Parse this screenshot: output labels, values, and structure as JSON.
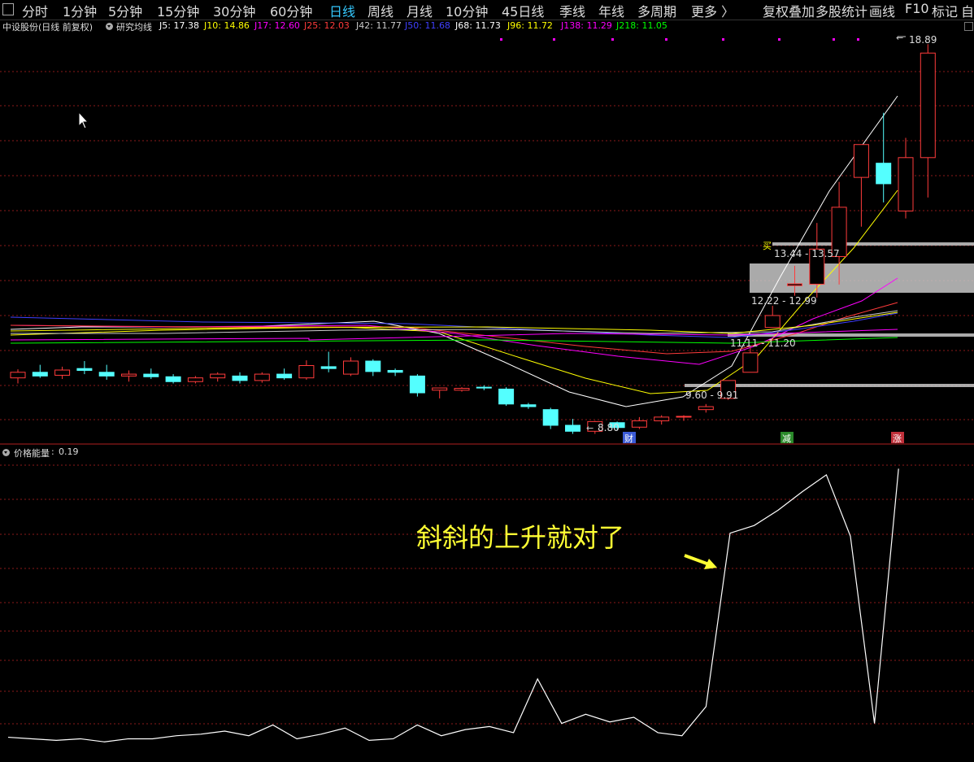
{
  "toolbar": {
    "periods": [
      "分时",
      "1分钟",
      "5分钟",
      "15分钟",
      "30分钟",
      "60分钟",
      "日线",
      "周线",
      "月线",
      "10分钟",
      "45日线",
      "季线",
      "年线",
      "多周期"
    ],
    "active_period": "日线",
    "more": "更多 〉",
    "tools": [
      "复权",
      "叠加",
      "多股",
      "统计",
      "画线",
      "F10",
      "标记",
      "自"
    ]
  },
  "indicator_header": {
    "stock": "中设股份(日线 前复权)",
    "indicator": "研究均线",
    "items": [
      {
        "label": "J5: 17.38",
        "color": "#ffffff"
      },
      {
        "label": "J10: 14.86",
        "color": "#ffff00"
      },
      {
        "label": "J17: 12.60",
        "color": "#ff00ff"
      },
      {
        "label": "J25: 12.03",
        "color": "#ff3b3b"
      },
      {
        "label": "J42: 11.77",
        "color": "#cccccc"
      },
      {
        "label": "J50: 11.68",
        "color": "#4040ff"
      },
      {
        "label": "J68: 11.73",
        "color": "#ffffff"
      },
      {
        "label": "J96: 11.72",
        "color": "#ffff00"
      },
      {
        "label": "J138: 11.29",
        "color": "#ff00ff"
      },
      {
        "label": "J218: 11.05",
        "color": "#00ff00"
      }
    ]
  },
  "price_labels": {
    "high": "18.89",
    "low": "8.80",
    "zones": [
      "13.44 - 13.57",
      "12.22 - 12.99",
      "11.11 - 11.20",
      "9.60 - 9.91"
    ],
    "buy_marker": "买"
  },
  "event_badges": [
    {
      "text": "财",
      "color": "#3b5bd6"
    },
    {
      "text": "减",
      "color": "#2a8a2a"
    },
    {
      "text": "涨",
      "color": "#c0303a"
    }
  ],
  "sub_chart": {
    "name": "价格能量",
    "value": "0.19"
  },
  "annotation": "斜斜的上升就对了",
  "colors": {
    "up": "#ff3b3b",
    "down": "#54ffff",
    "grid": "#8b1a1a",
    "zone": "#c8c8c8",
    "dots": "#ff00ff"
  },
  "chart_data": {
    "type": "candlestick",
    "candles": [
      {
        "o": 9.95,
        "h": 10.18,
        "l": 9.8,
        "c": 10.1
      },
      {
        "o": 10.1,
        "h": 10.3,
        "l": 9.95,
        "c": 10.0
      },
      {
        "o": 10.02,
        "h": 10.25,
        "l": 9.92,
        "c": 10.16
      },
      {
        "o": 10.2,
        "h": 10.4,
        "l": 10.05,
        "c": 10.15
      },
      {
        "o": 10.1,
        "h": 10.3,
        "l": 9.9,
        "c": 10.0
      },
      {
        "o": 10.0,
        "h": 10.15,
        "l": 9.85,
        "c": 10.05
      },
      {
        "o": 10.05,
        "h": 10.2,
        "l": 9.92,
        "c": 9.98
      },
      {
        "o": 9.98,
        "h": 10.05,
        "l": 9.8,
        "c": 9.85
      },
      {
        "o": 9.85,
        "h": 10.0,
        "l": 9.8,
        "c": 9.95
      },
      {
        "o": 9.95,
        "h": 10.1,
        "l": 9.85,
        "c": 10.05
      },
      {
        "o": 10.0,
        "h": 10.1,
        "l": 9.8,
        "c": 9.88
      },
      {
        "o": 9.88,
        "h": 10.1,
        "l": 9.82,
        "c": 10.05
      },
      {
        "o": 10.05,
        "h": 10.2,
        "l": 9.9,
        "c": 9.95
      },
      {
        "o": 9.95,
        "h": 10.42,
        "l": 9.9,
        "c": 10.28
      },
      {
        "o": 10.25,
        "h": 10.65,
        "l": 10.1,
        "c": 10.2
      },
      {
        "o": 10.05,
        "h": 10.5,
        "l": 10.0,
        "c": 10.4
      },
      {
        "o": 10.4,
        "h": 10.45,
        "l": 10.0,
        "c": 10.12
      },
      {
        "o": 10.15,
        "h": 10.2,
        "l": 10.0,
        "c": 10.1
      },
      {
        "o": 10.0,
        "h": 10.05,
        "l": 9.45,
        "c": 9.55
      },
      {
        "o": 9.62,
        "h": 9.68,
        "l": 9.4,
        "c": 9.68
      },
      {
        "o": 9.62,
        "h": 9.7,
        "l": 9.58,
        "c": 9.67
      },
      {
        "o": 9.7,
        "h": 9.75,
        "l": 9.62,
        "c": 9.68
      },
      {
        "o": 9.65,
        "h": 9.7,
        "l": 9.2,
        "c": 9.25
      },
      {
        "o": 9.23,
        "h": 9.28,
        "l": 9.12,
        "c": 9.18
      },
      {
        "o": 9.1,
        "h": 9.15,
        "l": 8.58,
        "c": 8.68
      },
      {
        "o": 8.68,
        "h": 8.85,
        "l": 8.45,
        "c": 8.52
      },
      {
        "o": 8.52,
        "h": 8.8,
        "l": 8.45,
        "c": 8.78
      },
      {
        "o": 8.75,
        "h": 8.78,
        "l": 8.55,
        "c": 8.62
      },
      {
        "o": 8.63,
        "h": 8.9,
        "l": 8.58,
        "c": 8.8
      },
      {
        "o": 8.8,
        "h": 8.95,
        "l": 8.7,
        "c": 8.9
      },
      {
        "o": 8.9,
        "h": 8.95,
        "l": 8.8,
        "c": 8.92
      },
      {
        "o": 9.1,
        "h": 9.25,
        "l": 9.02,
        "c": 9.18
      },
      {
        "o": 9.4,
        "h": 9.88,
        "l": 9.36,
        "c": 9.88
      },
      {
        "o": 10.1,
        "h": 10.75,
        "l": 10.1,
        "c": 10.62
      },
      {
        "o": 11.3,
        "h": 11.88,
        "l": 11.3,
        "c": 11.62
      },
      {
        "o": 12.42,
        "h": 12.95,
        "l": 12.15,
        "c": 12.47
      },
      {
        "o": 12.46,
        "h": 14.1,
        "l": 12.1,
        "c": 13.4
      },
      {
        "o": 13.2,
        "h": 15.2,
        "l": 12.45,
        "c": 14.52
      },
      {
        "o": 15.32,
        "h": 15.66,
        "l": 14.0,
        "c": 16.2
      },
      {
        "o": 15.7,
        "h": 17.05,
        "l": 14.65,
        "c": 15.15
      },
      {
        "o": 14.42,
        "h": 16.38,
        "l": 14.22,
        "c": 15.85
      },
      {
        "o": 15.85,
        "h": 18.89,
        "l": 14.78,
        "c": 18.65
      }
    ],
    "energy": [
      0.14,
      0.13,
      0.12,
      0.13,
      0.11,
      0.13,
      0.13,
      0.15,
      0.16,
      0.18,
      0.15,
      0.22,
      0.13,
      0.16,
      0.2,
      0.12,
      0.13,
      0.22,
      0.15,
      0.19,
      0.21,
      0.17,
      0.52,
      0.23,
      0.29,
      0.24,
      0.27,
      0.17,
      0.15,
      0.34,
      1.47,
      1.52,
      1.62,
      1.74,
      1.85,
      1.45,
      0.23,
      1.89
    ],
    "ylim": [
      8.2,
      19.2
    ],
    "grid": true
  }
}
